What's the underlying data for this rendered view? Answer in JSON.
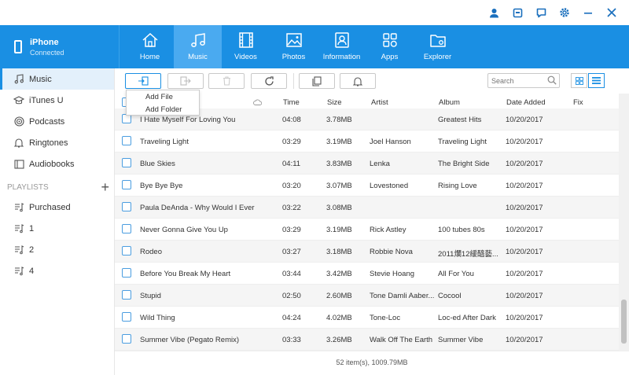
{
  "device": {
    "name": "iPhone",
    "status": "Connected"
  },
  "tabs": [
    {
      "label": "Home",
      "icon": "home-icon"
    },
    {
      "label": "Music",
      "icon": "music-icon",
      "active": true
    },
    {
      "label": "Videos",
      "icon": "film-icon"
    },
    {
      "label": "Photos",
      "icon": "photo-icon"
    },
    {
      "label": "Information",
      "icon": "contact-icon"
    },
    {
      "label": "Apps",
      "icon": "apps-icon"
    },
    {
      "label": "Explorer",
      "icon": "folder-icon"
    }
  ],
  "sidebar": {
    "items": [
      {
        "label": "Music",
        "icon": "music-note-icon",
        "active": true
      },
      {
        "label": "iTunes U",
        "icon": "graduation-icon"
      },
      {
        "label": "Podcasts",
        "icon": "podcast-icon"
      },
      {
        "label": "Ringtones",
        "icon": "bell-icon"
      },
      {
        "label": "Audiobooks",
        "icon": "book-icon"
      }
    ],
    "playlists_header": "PLAYLISTS",
    "playlists": [
      {
        "label": "Purchased"
      },
      {
        "label": "1"
      },
      {
        "label": "2"
      },
      {
        "label": "4"
      }
    ]
  },
  "toolbar": {
    "search_placeholder": "Search"
  },
  "dropdown": {
    "items": [
      "Add File",
      "Add Folder"
    ]
  },
  "table": {
    "headers": [
      "Time",
      "Size",
      "Artist",
      "Album",
      "Date Added",
      "Fix"
    ],
    "rows": [
      [
        "I Hate Myself For Loving You",
        "04:08",
        "3.78MB",
        "",
        "Greatest Hits",
        "10/20/2017"
      ],
      [
        "Traveling Light",
        "03:29",
        "3.19MB",
        "Joel Hanson",
        "Traveling Light",
        "10/20/2017"
      ],
      [
        "Blue Skies",
        "04:11",
        "3.83MB",
        "Lenka",
        "The Bright Side",
        "10/20/2017"
      ],
      [
        "Bye Bye Bye",
        "03:20",
        "3.07MB",
        "Lovestoned",
        "Rising Love",
        "10/20/2017"
      ],
      [
        "Paula DeAnda - Why Would I Ever",
        "03:22",
        "3.08MB",
        "",
        "",
        "10/20/2017"
      ],
      [
        "Never Gonna Give You Up",
        "03:29",
        "3.19MB",
        "Rick Astley",
        "100 tubes 80s",
        "10/20/2017"
      ],
      [
        "Rodeo",
        "03:27",
        "3.18MB",
        "Robbie Nova",
        "2011爛12緩醯藝...",
        "10/20/2017"
      ],
      [
        "Before You Break My Heart",
        "03:44",
        "3.42MB",
        "Stevie Hoang",
        "All For You",
        "10/20/2017"
      ],
      [
        "Stupid",
        "02:50",
        "2.60MB",
        "Tone Damli Aaber...",
        "Cocool",
        "10/20/2017"
      ],
      [
        "Wild Thing",
        "04:24",
        "4.02MB",
        "Tone-Loc",
        "Loc-ed After Dark",
        "10/20/2017"
      ],
      [
        "Summer Vibe (Pegato Remix)",
        "03:33",
        "3.26MB",
        "Walk Off The Earth",
        "Summer Vibe",
        "10/20/2017"
      ]
    ]
  },
  "status": "52 item(s), 1009.79MB",
  "colors": {
    "accent": "#1a8fe3",
    "active_tab": "#4aaaf0",
    "sidebar_active": "#e3f0fb"
  }
}
